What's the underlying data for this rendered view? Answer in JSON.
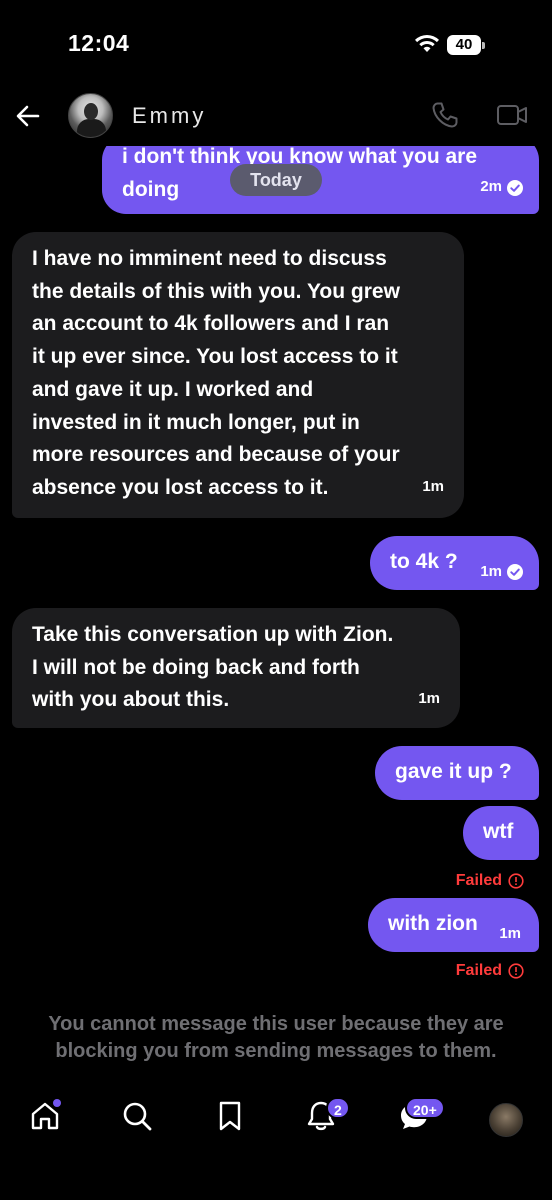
{
  "status_bar": {
    "time": "12:04",
    "battery": "40"
  },
  "header": {
    "contact_name": "Emmy"
  },
  "date_separator": "Today",
  "messages": [
    {
      "direction": "out",
      "lines": [
        "i don't think you know what you are",
        "doing"
      ],
      "time": "2m",
      "read": true
    },
    {
      "direction": "in",
      "lines": [
        "I have no imminent need to discuss",
        "the details of this with you. You grew",
        "an account to 4k followers and I ran",
        "it up ever since. You lost access to it",
        "and gave it up. I worked and",
        "invested in it much longer, put in",
        "more resources and because of your",
        "absence you lost access to it."
      ],
      "time": "1m"
    },
    {
      "direction": "out",
      "lines": [
        "to 4k ?"
      ],
      "time": "1m",
      "read": true
    },
    {
      "direction": "in",
      "lines": [
        "Take this conversation up with Zion.",
        "I will not be doing back and forth",
        "with you about this."
      ],
      "time": "1m"
    },
    {
      "direction": "out",
      "lines": [
        "gave it up ?"
      ]
    },
    {
      "direction": "out",
      "lines": [
        "wtf"
      ],
      "status": "Failed"
    },
    {
      "direction": "out",
      "lines": [
        "with zion"
      ],
      "time": "1m",
      "status": "Failed"
    }
  ],
  "blocked_notice": [
    "You cannot message this user because they are",
    "blocking you from sending messages to them."
  ],
  "nav": {
    "items": [
      "home-icon",
      "search-icon",
      "bookmark-icon",
      "notifications-icon",
      "messages-icon",
      "profile-avatar"
    ],
    "notifications_badge": "2",
    "messages_badge": "20+"
  },
  "colors": {
    "accent": "#7457f0",
    "incoming_bubble": "#1c1c1e",
    "failed": "#ff3b3b",
    "background": "#000000"
  }
}
